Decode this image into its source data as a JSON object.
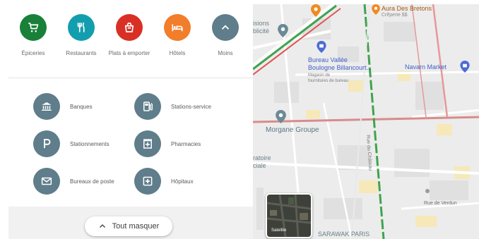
{
  "categories": [
    {
      "label": "Épiceries",
      "icon": "cart-icon",
      "color": "#188038"
    },
    {
      "label": "Restaurants",
      "icon": "fork-knife-icon",
      "color": "#129eaf"
    },
    {
      "label": "Plats à emporter",
      "icon": "takeout-bag-icon",
      "color": "#d93025"
    },
    {
      "label": "Hôtels",
      "icon": "bed-icon",
      "color": "#f27d2a"
    },
    {
      "label": "Moins",
      "icon": "chevron-up-icon",
      "color": "#5f7d8a"
    }
  ],
  "more_categories": [
    {
      "label": "Banques",
      "icon": "bank-icon"
    },
    {
      "label": "Stations-service",
      "icon": "fuel-icon"
    },
    {
      "label": "Stationnements",
      "icon": "parking-icon"
    },
    {
      "label": "Pharmacies",
      "icon": "pharmacy-icon"
    },
    {
      "label": "Bureaux de poste",
      "icon": "mail-icon"
    },
    {
      "label": "Hôpitaux",
      "icon": "hospital-icon"
    }
  ],
  "more_icon_color": "#5f7d8a",
  "hide_all_label": "Tout masquer",
  "map": {
    "labels": {
      "top_place": "Aura Des Bretons",
      "top_place_sub": "Crêperie $$",
      "cut_left_1a": "isions",
      "cut_left_1b": "blicité",
      "bureau_title_1": "Bureau Vallée",
      "bureau_title_2": "Boulogne Billancourt...",
      "bureau_sub_1": "Magasin de",
      "bureau_sub_2": "fournitures de bureau",
      "navarn": "Navarn Market",
      "morgane": "Morgane Groupe",
      "cut_left_2a": "ratoire",
      "cut_left_2b": "ciale",
      "street_vertical": "Rue du Château",
      "street_verdun": "Rue de Verdun",
      "sarawak": "SARAWAK PARIS"
    },
    "satellite_label": "Satellite"
  }
}
